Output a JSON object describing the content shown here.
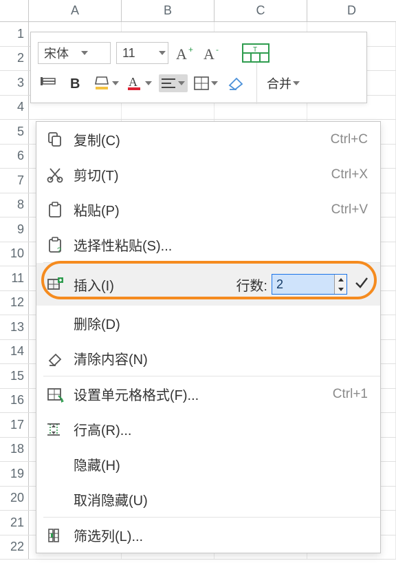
{
  "columns": [
    "A",
    "B",
    "C",
    "D"
  ],
  "row_count": 22,
  "toolbar": {
    "font_name": "宋体",
    "font_size": "11",
    "merge_label": "合并"
  },
  "context_menu": {
    "items": [
      {
        "key": "copy",
        "label": "复制(C)",
        "shortcut": "Ctrl+C",
        "icon": "copy"
      },
      {
        "key": "cut",
        "label": "剪切(T)",
        "shortcut": "Ctrl+X",
        "icon": "cut"
      },
      {
        "key": "paste",
        "label": "粘贴(P)",
        "shortcut": "Ctrl+V",
        "icon": "paste"
      },
      {
        "key": "paste-spec",
        "label": "选择性粘贴(S)...",
        "shortcut": "",
        "icon": "paste-q"
      },
      {
        "key": "insert",
        "label": "插入(I)",
        "shortcut": "",
        "icon": "insert",
        "hover": true,
        "row_label": "行数:",
        "row_value": "2"
      },
      {
        "key": "delete",
        "label": "删除(D)",
        "shortcut": "",
        "icon": ""
      },
      {
        "key": "clear",
        "label": "清除内容(N)",
        "shortcut": "",
        "icon": "eraser"
      },
      {
        "key": "format",
        "label": "设置单元格格式(F)...",
        "shortcut": "Ctrl+1",
        "icon": "format-cells"
      },
      {
        "key": "row-height",
        "label": "行高(R)...",
        "shortcut": "",
        "icon": "row-height"
      },
      {
        "key": "hide",
        "label": "隐藏(H)",
        "shortcut": "",
        "icon": ""
      },
      {
        "key": "unhide",
        "label": "取消隐藏(U)",
        "shortcut": "",
        "icon": ""
      },
      {
        "key": "filter",
        "label": "筛选列(L)...",
        "shortcut": "",
        "icon": "filter"
      }
    ]
  }
}
